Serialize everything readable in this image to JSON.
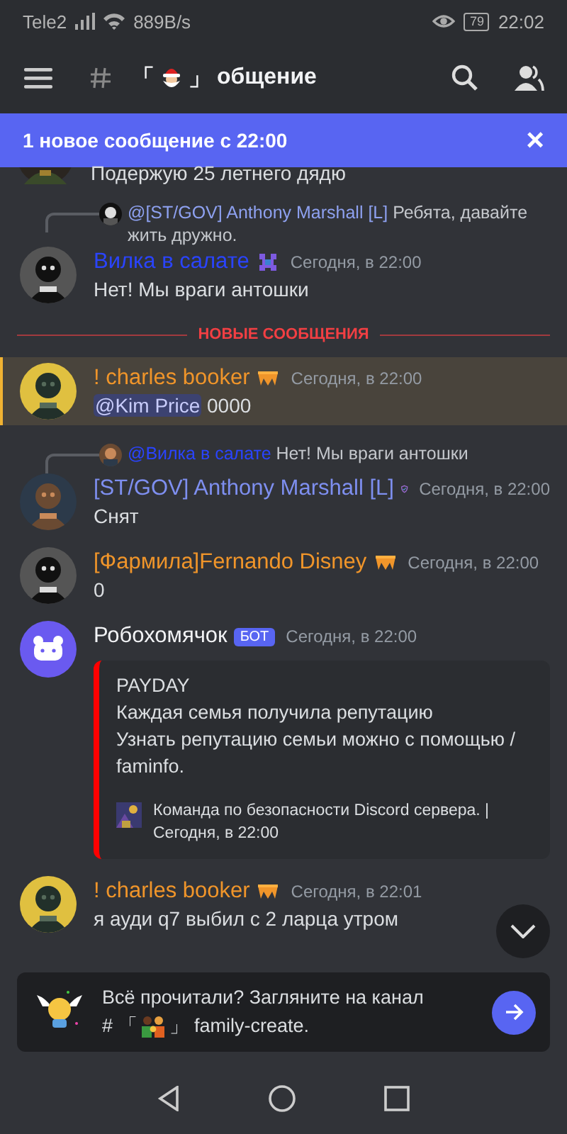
{
  "status_bar": {
    "carrier": "Tele2",
    "speed": "889B/s",
    "battery": "79",
    "time": "22:02"
  },
  "header": {
    "bracket_open": "「",
    "bracket_close": "」",
    "channel": "общение"
  },
  "banner": {
    "text": "1 новое сообщение с 22:00",
    "close": "×"
  },
  "messages": [
    {
      "kind": "partial",
      "text": "Подержую 25 летнего дядю"
    },
    {
      "kind": "message",
      "reply": {
        "author": "@[ST/GOV] Anthony Marshall [L]",
        "color": "#8ea1f0",
        "text": "Ребята, давайте жить дружно."
      },
      "author": "Вилка в салате",
      "color": "#2a44ff",
      "badge": {
        "kind": "pixel"
      },
      "time": "Сегодня, в 22:00",
      "text": "Нет! Мы враги антошки"
    },
    {
      "kind": "divider",
      "text": "НОВЫЕ СООБЩЕНИЯ"
    },
    {
      "kind": "mention",
      "author": "! charles booker",
      "color": "#f0952a",
      "badge": {
        "kind": "crown"
      },
      "time": "Сегодня, в 22:00",
      "mention": "@Kim Price",
      "text": "0000"
    },
    {
      "kind": "message",
      "reply": {
        "author": "@Вилка в салате",
        "color": "#2a44ff",
        "text": "Нет! Мы враги антошки"
      },
      "author": "[ST/GOV] Anthony Marshall [L]",
      "color": "#7e8ff0",
      "badge": {
        "kind": "shield"
      },
      "time": "Сегодня, в 22:00",
      "text": "Снят"
    },
    {
      "kind": "message",
      "author": "[Фармила]Fernando Disney",
      "color": "#f0952a",
      "badge": {
        "kind": "crown"
      },
      "time": "Сегодня, в 22:00",
      "text": "0"
    },
    {
      "kind": "bot",
      "author": "Робохомячок",
      "color": "#f2f3f5",
      "tag": "БОТ",
      "time": "Сегодня, в 22:00",
      "embed": {
        "title": "PAYDAY",
        "lines": [
          "Каждая семья получила репутацию",
          "Узнать репутацию семьи можно с помощью / faminfo."
        ],
        "footer": "Команда по безопасности Discord сервера. | Сегодня, в 22:00"
      }
    },
    {
      "kind": "message",
      "author": "! charles booker",
      "color": "#f0952a",
      "badge": {
        "kind": "crown"
      },
      "time": "Сегодня, в 22:01",
      "text": "я ауди q7 выбил с 2 ларца утром"
    }
  ],
  "prompt": {
    "line1": "Всё прочитали? Загляните на канал",
    "prefix": "# 「",
    "suffix": "」 family-create."
  }
}
